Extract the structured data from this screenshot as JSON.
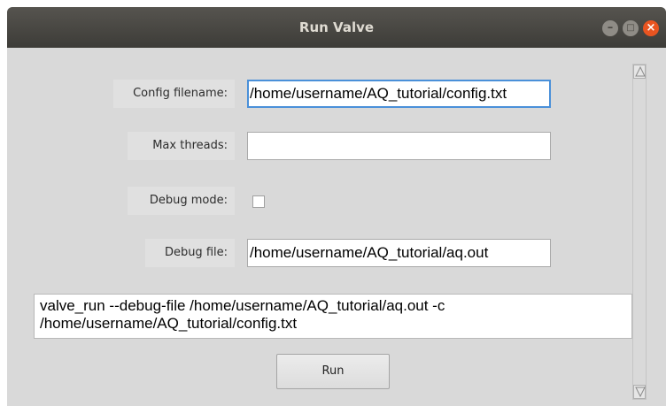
{
  "window": {
    "title": "Run Valve",
    "controls": {
      "minimize": "–",
      "maximize": "□",
      "close": "×"
    }
  },
  "form": {
    "config_filename": {
      "label": "Config filename:",
      "value": "/home/username/AQ_tutorial/config.txt"
    },
    "max_threads": {
      "label": "Max threads:",
      "value": ""
    },
    "debug_mode": {
      "label": "Debug mode:",
      "checked": false
    },
    "debug_file": {
      "label": "Debug file:",
      "value": "/home/username/AQ_tutorial/aq.out"
    }
  },
  "command_preview": {
    "line1": "valve_run --debug-file /home/username/AQ_tutorial/aq.out -c",
    "line2": "/home/username/AQ_tutorial/config.txt"
  },
  "run_button": {
    "label": "Run"
  },
  "icons": {
    "scroll_up": "triangle-up-icon",
    "scroll_down": "triangle-down-icon"
  },
  "colors": {
    "titlebar": "#45433f",
    "close_button": "#e95420",
    "focus_border": "#4a90d9",
    "window_bg": "#d9d9d9"
  }
}
